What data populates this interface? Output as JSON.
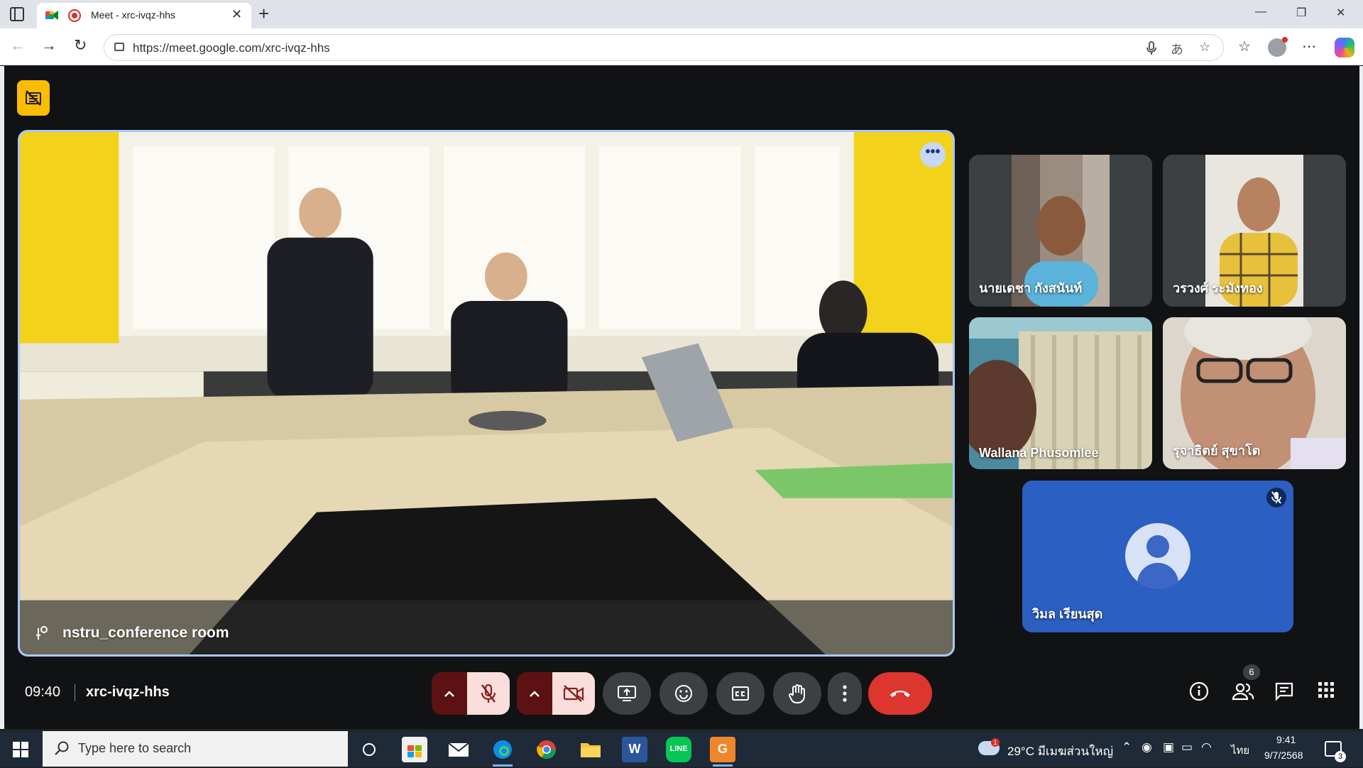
{
  "browser": {
    "tab_title": "Meet - xrc-ivqz-hhs",
    "url": "https://meet.google.com/xrc-ivqz-hhs",
    "new_tab_label": "+",
    "tab_close_label": "✕",
    "window_controls": {
      "minimize": "—",
      "restore": "❐",
      "close": "✕"
    }
  },
  "meeting": {
    "time": "09:40",
    "code": "xrc-ivqz-hhs",
    "participant_count": "6",
    "main_speaker": "nstru_conference room",
    "tile_more_label": "•••",
    "participants": [
      {
        "name": "นายเดชา กังสนันท์"
      },
      {
        "name": "วรวงศ์ ระมังทอง"
      },
      {
        "name": "Wallana Phusomlee"
      },
      {
        "name": "รุจาธิตย์ สุขาโต"
      },
      {
        "name": "วิมล เรียนสุด",
        "muted": true
      }
    ]
  },
  "controls": {
    "mic": "microphone-off",
    "camera": "camera-off",
    "present": "present-screen",
    "reactions": "emoji",
    "captions": "captions",
    "raise_hand": "raise-hand",
    "more": "more-options",
    "end_call": "leave-call"
  },
  "taskbar": {
    "search_placeholder": "Type here to search",
    "weather": "29°C  มีเมฆส่วนใหญ่",
    "weather_alert": "1",
    "language": "ไทย",
    "time": "9:41",
    "date": "9/7/2568",
    "notification_count": "3"
  },
  "colors": {
    "meet_background": "#111214",
    "active_speaker_border": "#a8c7fa",
    "end_call": "#dc362e",
    "recording_badge": "#fbbc04",
    "muted_control_bg": "#f9dedc"
  }
}
